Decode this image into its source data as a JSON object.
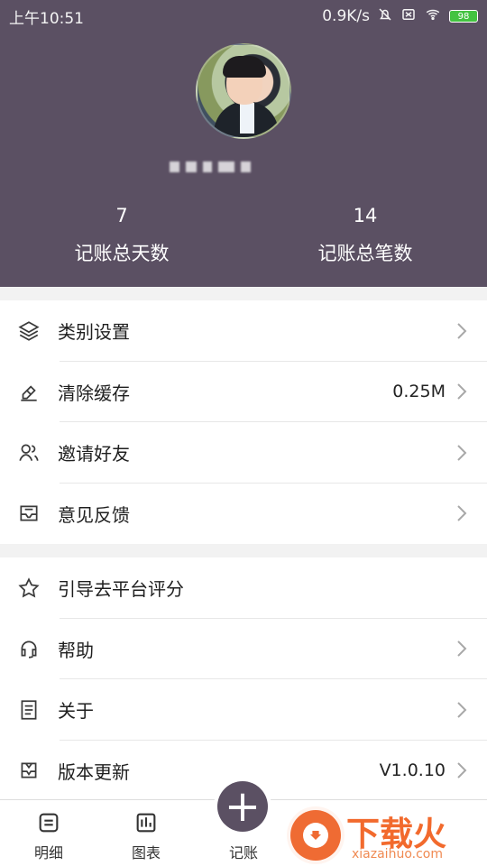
{
  "status_bar": {
    "time": "上午10:51",
    "network_speed": "0.9K/s",
    "battery": "98"
  },
  "profile": {
    "stats": [
      {
        "value": "7",
        "label": "记账总天数"
      },
      {
        "value": "14",
        "label": "记账总笔数"
      }
    ]
  },
  "settings": {
    "group1": [
      {
        "label": "类别设置",
        "value": ""
      },
      {
        "label": "清除缓存",
        "value": "0.25M"
      },
      {
        "label": "邀请好友",
        "value": ""
      },
      {
        "label": "意见反馈",
        "value": ""
      }
    ],
    "group2": [
      {
        "label": "引导去平台评分",
        "value": ""
      },
      {
        "label": "帮助",
        "value": ""
      },
      {
        "label": "关于",
        "value": ""
      },
      {
        "label": "版本更新",
        "value": "V1.0.10"
      }
    ]
  },
  "bottom_nav": [
    {
      "label": "明细"
    },
    {
      "label": "图表"
    },
    {
      "label": "记账"
    }
  ],
  "watermark": {
    "title": "下载火",
    "site": "xiazaihuo.com"
  },
  "colors": {
    "header": "#5b5063",
    "accent": "#5b5063",
    "watermark": "#f26a2d"
  },
  "icons": {
    "layers": "layers-icon",
    "eraser": "eraser-icon",
    "friends": "users-icon",
    "feedback": "inbox-icon",
    "rating": "star-icon",
    "help": "headset-icon",
    "about": "document-icon",
    "update": "package-icon"
  }
}
